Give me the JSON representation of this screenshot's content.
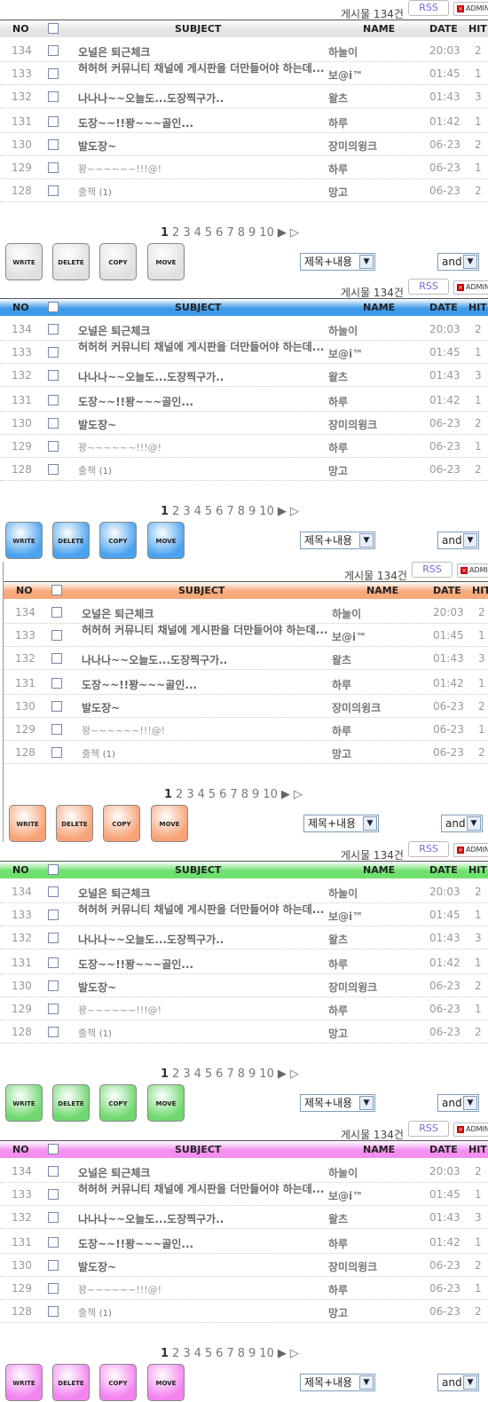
{
  "board": {
    "count_label": "게시물 134건",
    "rss_label": "RSS",
    "admin_label": "ADMIN",
    "headers": {
      "no": "NO",
      "subject": "SUBJECT",
      "name": "NAME",
      "date": "DATE",
      "hit": "HIT"
    },
    "rows": [
      {
        "no": "134",
        "subject": "오널은 퇴근체크",
        "name": "하눌이",
        "date": "20:03",
        "hit": "2"
      },
      {
        "no": "133",
        "subject": "허허허 커뮤니티 채널에 게시판을 더만들어야 하는데...",
        "name": "보@i™",
        "date": "01:45",
        "hit": "1"
      },
      {
        "no": "132",
        "subject": "나나나~~오늘도...도장찍구가..",
        "name": "왈츠",
        "date": "01:43",
        "hit": "3"
      },
      {
        "no": "131",
        "subject": "도장~~!!꽝~~~골인...",
        "name": "하루",
        "date": "01:42",
        "hit": "1"
      },
      {
        "no": "130",
        "subject": "발도장~",
        "name": "장미의윙크",
        "date": "06-23",
        "hit": "2"
      },
      {
        "no": "129",
        "subject": "꽝~~~~~~!!!@!",
        "name": "하루",
        "date": "06-23",
        "hit": "1"
      },
      {
        "no": "128",
        "subject": "출첵",
        "comment": "(1)",
        "name": "망고",
        "date": "06-23",
        "hit": "2"
      }
    ],
    "pages": [
      "1",
      "2",
      "3",
      "4",
      "5",
      "6",
      "7",
      "8",
      "9",
      "10"
    ],
    "next_label": "▶",
    "last_label": "▷",
    "buttons": {
      "write": "WRITE",
      "delete": "DELETE",
      "copy": "COPY",
      "move": "MOVE"
    },
    "search_field": "제목+내용",
    "search_op": "and"
  },
  "themes": [
    {
      "name": "gray",
      "header": "#e4e4e4",
      "button": "#e0e0e0"
    },
    {
      "name": "blue",
      "header": "#3e9bea",
      "button": "#4aa3ef"
    },
    {
      "name": "orange",
      "header": "#f7a97a",
      "button": "#f6a378"
    },
    {
      "name": "green",
      "header": "#6ee06e",
      "button": "#6fd86f"
    },
    {
      "name": "pink",
      "header": "#f48ff1",
      "button": "#f283ef"
    }
  ]
}
